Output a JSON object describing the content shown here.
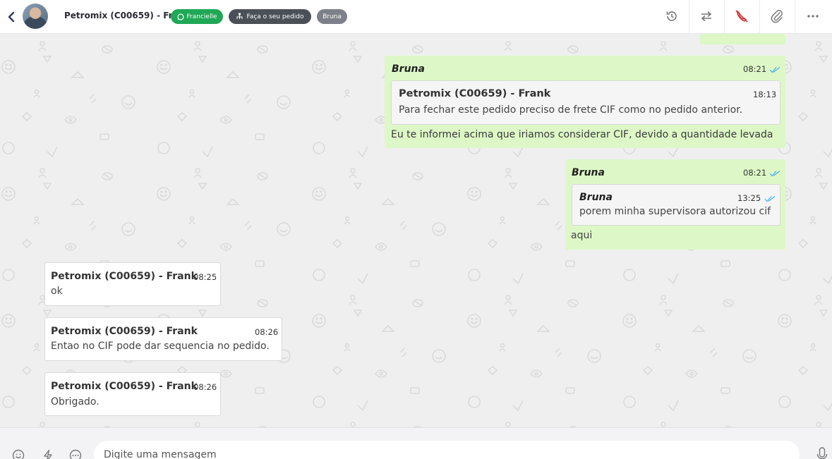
{
  "header": {
    "contact_name": "Petromix (C00659) - Frank",
    "tags": {
      "whatsapp": "Francielle",
      "order": "Faça o seu pedido",
      "agent": "Bruna"
    },
    "actions": [
      "history-icon",
      "transfer-icon",
      "end-call-icon",
      "attach-icon",
      "more-icon"
    ]
  },
  "colors": {
    "outgoing_bubble": "#ddf8c6",
    "incoming_bubble": "#ffffff",
    "whatsapp_tag": "#1fa855",
    "read_check": "#4fb3e8",
    "end_call": "#d23a3a"
  },
  "messages": [
    {
      "direction": "out",
      "sender": "Bruna",
      "time": "08:21",
      "quote": {
        "sender": "Petromix (C00659) - Frank",
        "time": "18:13",
        "text": "Para fechar este pedido preciso de frete CIF como no pedido anterior."
      },
      "text": "Eu te informei acima que iriamos considerar CIF, devido a quantidade levada"
    },
    {
      "direction": "out",
      "sender": "Bruna",
      "time": "08:21",
      "quote": {
        "sender": "Bruna",
        "time": "13:25",
        "text": "porem minha supervisora autorizou cif"
      },
      "text": "aqui"
    },
    {
      "direction": "in",
      "sender": "Petromix (C00659) - Frank",
      "time": "08:25",
      "text": "ok"
    },
    {
      "direction": "in",
      "sender": "Petromix (C00659) - Frank",
      "time": "08:26",
      "text": "Entao no CIF pode dar sequencia no pedido."
    },
    {
      "direction": "in",
      "sender": "Petromix (C00659) - Frank",
      "time": "08:26",
      "text": "Obrigado."
    }
  ],
  "composer": {
    "placeholder": "Digite uma mensagem"
  }
}
